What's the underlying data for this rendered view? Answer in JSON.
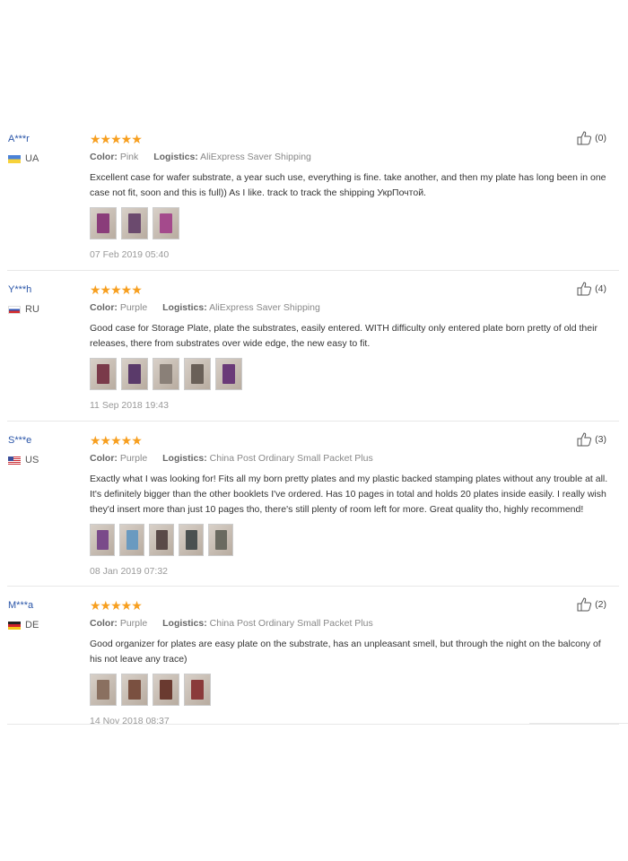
{
  "labels": {
    "color": "Color:",
    "logistics": "Logistics:"
  },
  "reviews": [
    {
      "user": "A***r",
      "country": "UA",
      "flag": "ua",
      "stars": "★★★★★",
      "color": "Pink",
      "logistics": "AliExpress Saver Shipping",
      "text": "Excellent case for wafer substrate, a year such use, everything is fine. take another, and then my plate has long been in one case not fit, soon and this is full)) As I like. track to track the shipping УкрПочтой.",
      "photos": [
        "#8a3d7a",
        "#6b4a6e",
        "#a44a8c"
      ],
      "date": "07 Feb 2019 05:40",
      "likes": "(0)"
    },
    {
      "user": "Y***h",
      "country": "RU",
      "flag": "ru",
      "stars": "★★★★★",
      "color": "Purple",
      "logistics": "AliExpress Saver Shipping",
      "text": "Good case for Storage Plate, plate the substrates, easily entered. WITH difficulty only entered plate born pretty of old their releases, there from substrates over wide edge, the new easy to fit.",
      "photos": [
        "#7a3a4a",
        "#5a3a6a",
        "#8a8078",
        "#6a6058",
        "#6a3a78"
      ],
      "date": "11 Sep 2018 19:43",
      "likes": "(4)"
    },
    {
      "user": "S***e",
      "country": "US",
      "flag": "us",
      "stars": "★★★★★",
      "color": "Purple",
      "logistics": "China Post Ordinary Small Packet Plus",
      "text": "Exactly what I was looking for! Fits all my born pretty plates and my plastic backed stamping plates without any trouble at all. It's definitely bigger than the other booklets I've ordered. Has 10 pages in total and holds 20 plates inside easily. I really wish they'd insert more than just 10 pages tho, there's still plenty of room left for more. Great quality tho, highly recommend!",
      "photos": [
        "#7a4a8a",
        "#6a9ac0",
        "#5a4a48",
        "#4a5050",
        "#6a6a60"
      ],
      "date": "08 Jan 2019 07:32",
      "likes": "(3)"
    },
    {
      "user": "M***a",
      "country": "DE",
      "flag": "de",
      "stars": "★★★★★",
      "color": "Purple",
      "logistics": "China Post Ordinary Small Packet Plus",
      "text": "Good organizer for plates are easy plate on the substrate, has an unpleasant smell, but through the night on the balcony of his not leave any trace)",
      "photos": [
        "#8a7060",
        "#7a5040",
        "#6a3a30",
        "#8a3a3a"
      ],
      "date": "14 Nov 2018 08:37",
      "likes": "(2)"
    }
  ]
}
